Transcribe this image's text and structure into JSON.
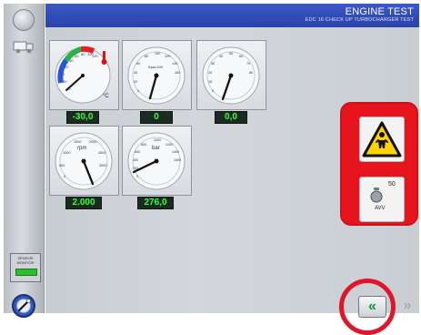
{
  "header": {
    "title": "ENGINE TEST",
    "subtitle": "EDC 16 CHECK UP TURBOCHARGER TEST"
  },
  "sidebar": {
    "top_icon": "circle-button-icon",
    "second_icon": "truck-icon",
    "mini_panel_label": "SENSOR MONITOR",
    "bottom_icon": "compass-icon"
  },
  "gauges": [
    {
      "name": "temperature",
      "unit": "°C",
      "value_text": "-30,0",
      "scale_labels": [
        "40",
        "20",
        "0",
        "20",
        "40",
        "60",
        "80",
        "100",
        "120"
      ]
    },
    {
      "name": "gauge-2",
      "dial_label": "Kpa×100",
      "value_text": "0",
      "scale_labels": [
        "0",
        "20",
        "40",
        "60",
        "80",
        "100",
        "120",
        "140",
        "160"
      ]
    },
    {
      "name": "gauge-3",
      "dial_label": "",
      "value_text": "0,0",
      "scale_labels": [
        "0",
        "10",
        "20",
        "30",
        "40",
        "50",
        "60",
        "70",
        "80"
      ]
    },
    {
      "name": "rpm",
      "dial_label": "rpm",
      "value_text": "2.000",
      "scale_labels": [
        "0",
        "500",
        "1000",
        "1500",
        "2000",
        "2500",
        "3000"
      ]
    },
    {
      "name": "pressure",
      "dial_label": "bar",
      "value_text": "276,0",
      "scale_labels": [
        "0",
        "200",
        "400",
        "600",
        "800",
        "1000",
        "1200",
        "1400",
        "1600"
      ]
    }
  ],
  "warning_panel": {
    "icon": "warning-person-icon",
    "avv_number": "50",
    "avv_label": "AVV"
  },
  "nav": {
    "back_symbol": "«",
    "forward_symbol": "»"
  }
}
